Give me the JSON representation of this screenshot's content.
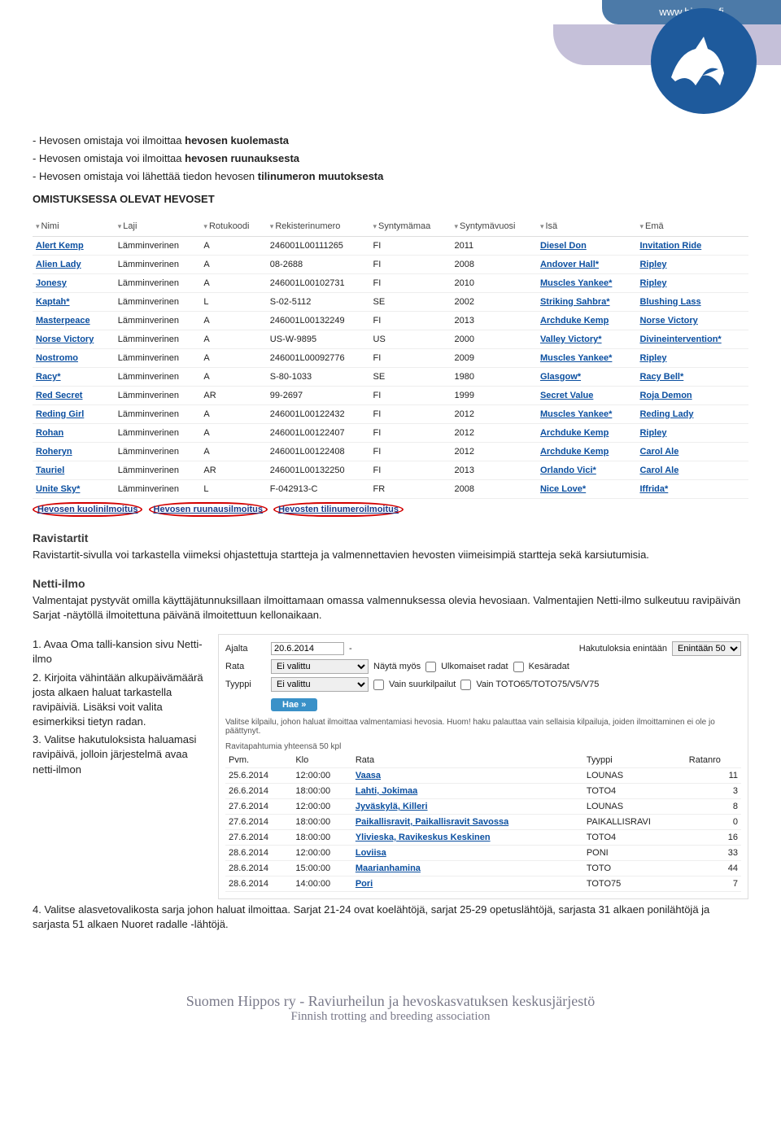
{
  "header": {
    "site_url": "www.hippos.fi"
  },
  "intro": {
    "line1_prefix": "- Hevosen omistaja voi ilmoittaa ",
    "line1_bold": "hevosen kuolemasta",
    "line2_prefix": "- Hevosen omistaja voi ilmoittaa ",
    "line2_bold": "hevosen ruunauksesta",
    "line3_prefix": "- Hevosen omistaja voi lähettää tiedon hevosen ",
    "line3_bold": "tilinumeron muutoksesta"
  },
  "horses_table": {
    "title": "OMISTUKSESSA OLEVAT HEVOSET",
    "headers": [
      "Nimi",
      "Laji",
      "Rotukoodi",
      "Rekisterinumero",
      "Syntymämaa",
      "Syntymävuosi",
      "Isä",
      "Emä"
    ],
    "rows": [
      [
        "Alert Kemp",
        "Lämminverinen",
        "A",
        "246001L00111265",
        "FI",
        "2011",
        "Diesel Don",
        "Invitation Ride"
      ],
      [
        "Alien Lady",
        "Lämminverinen",
        "A",
        "08-2688",
        "FI",
        "2008",
        "Andover Hall*",
        "Ripley"
      ],
      [
        "Jonesy",
        "Lämminverinen",
        "A",
        "246001L00102731",
        "FI",
        "2010",
        "Muscles Yankee*",
        "Ripley"
      ],
      [
        "Kaptah*",
        "Lämminverinen",
        "L",
        "S-02-5112",
        "SE",
        "2002",
        "Striking Sahbra*",
        "Blushing Lass"
      ],
      [
        "Masterpeace",
        "Lämminverinen",
        "A",
        "246001L00132249",
        "FI",
        "2013",
        "Archduke Kemp",
        "Norse Victory"
      ],
      [
        "Norse Victory",
        "Lämminverinen",
        "A",
        "US-W-9895",
        "US",
        "2000",
        "Valley Victory*",
        "Divineintervention*"
      ],
      [
        "Nostromo",
        "Lämminverinen",
        "A",
        "246001L00092776",
        "FI",
        "2009",
        "Muscles Yankee*",
        "Ripley"
      ],
      [
        "Racy*",
        "Lämminverinen",
        "A",
        "S-80-1033",
        "SE",
        "1980",
        "Glasgow*",
        "Racy Bell*"
      ],
      [
        "Red Secret",
        "Lämminverinen",
        "AR",
        "99-2697",
        "FI",
        "1999",
        "Secret Value",
        "Roja Demon"
      ],
      [
        "Reding Girl",
        "Lämminverinen",
        "A",
        "246001L00122432",
        "FI",
        "2012",
        "Muscles Yankee*",
        "Reding Lady"
      ],
      [
        "Rohan",
        "Lämminverinen",
        "A",
        "246001L00122407",
        "FI",
        "2012",
        "Archduke Kemp",
        "Ripley"
      ],
      [
        "Roheryn",
        "Lämminverinen",
        "A",
        "246001L00122408",
        "FI",
        "2012",
        "Archduke Kemp",
        "Carol Ale"
      ],
      [
        "Tauriel",
        "Lämminverinen",
        "AR",
        "246001L00132250",
        "FI",
        "2013",
        "Orlando Vici*",
        "Carol Ale"
      ],
      [
        "Unite Sky*",
        "Lämminverinen",
        "L",
        "F-042913-C",
        "FR",
        "2008",
        "Nice Love*",
        "Iffrida*"
      ]
    ],
    "actions": [
      "Hevosen kuolinilmoitus",
      "Hevosen ruunausilmoitus",
      "Hevosten tilinumeroilmoitus"
    ]
  },
  "ravistartit": {
    "title": "Ravistartit",
    "body": "Ravistartit-sivulla voi tarkastella viimeksi ohjastettuja startteja ja valmennettavien hevosten viimeisimpiä startteja sekä karsiutumisia."
  },
  "nettiIlmo": {
    "title": "Netti-ilmo",
    "body1": "Valmentajat pystyvät omilla käyttäjätunnuksillaan ilmoittamaan omassa valmennuksessa olevia hevosiaan. Valmentajien Netti-ilmo sulkeutuu ravipäivän Sarjat -näytöllä ilmoitettuna päivänä ilmoitettuun kellonaikaan.",
    "steps": {
      "s1": "1. Avaa Oma talli-kansion sivu Netti-ilmo",
      "s2": "2. Kirjoita vähintään alkupäivämäärä josta alkaen haluat tarkastella ravipäiviä. Lisäksi voit valita esimerkiksi tietyn radan.",
      "s3": "3. Valitse hakutuloksista haluamasi ravipäivä, jolloin järjestelmä avaa netti-ilmon",
      "s4": "4. Valitse alasvetovalikosta sarja johon haluat ilmoittaa. Sarjat 21-24 ovat koelähtöjä, sarjat 25-29 opetuslähtöjä, sarjasta 31 alkaen ponilähtöjä ja sarjasta 51 alkaen Nuoret radalle -lähtöjä."
    }
  },
  "search": {
    "labels": {
      "ajalta": "Ajalta",
      "rata": "Rata",
      "tyyppi": "Tyyppi",
      "hakutuloksia": "Hakutuloksia enintään",
      "nayta_myos": "Näytä myös",
      "vain_suurkilpailut": "Vain suurkilpailut",
      "vain_toto": "Vain TOTO65/TOTO75/V5/V75"
    },
    "values": {
      "date_from": "20.6.2014",
      "limit": "Enintään 50",
      "rata": "Ei valittu",
      "tyyppi": "Ei valittu",
      "cb_ulkomaiset": "Ulkomaiset radat",
      "cb_kesaradat": "Kesäradat",
      "hae": "Hae »",
      "summary": "Valitse kilpailu, johon haluat ilmoittaa valmentamiasi hevosia. Huom! haku palauttaa vain sellaisia kilpailuja, joiden ilmoittaminen ei ole jo päättynyt.",
      "count": "Ravitapahtumia yhteensä 50 kpl"
    },
    "results": {
      "headers": [
        "Pvm.",
        "Klo",
        "Rata",
        "Tyyppi",
        "Ratanro"
      ],
      "rows": [
        [
          "25.6.2014",
          "12:00:00",
          "Vaasa",
          "LOUNAS",
          "11"
        ],
        [
          "26.6.2014",
          "18:00:00",
          "Lahti, Jokimaa",
          "TOTO4",
          "3"
        ],
        [
          "27.6.2014",
          "12:00:00",
          "Jyväskylä, Killeri",
          "LOUNAS",
          "8"
        ],
        [
          "27.6.2014",
          "18:00:00",
          "Paikallisravit, Paikallisravit Savossa",
          "PAIKALLISRAVI",
          "0"
        ],
        [
          "27.6.2014",
          "18:00:00",
          "Ylivieska, Ravikeskus Keskinen",
          "TOTO4",
          "16"
        ],
        [
          "28.6.2014",
          "12:00:00",
          "Loviisa",
          "PONI",
          "33"
        ],
        [
          "28.6.2014",
          "15:00:00",
          "Maarianhamina",
          "TOTO",
          "44"
        ],
        [
          "28.6.2014",
          "14:00:00",
          "Pori",
          "TOTO75",
          "7"
        ]
      ]
    }
  },
  "footer": {
    "line1": "Suomen Hippos ry - Raviurheilun ja hevoskasvatuksen keskusjärjestö",
    "line2": "Finnish trotting and breeding association"
  }
}
